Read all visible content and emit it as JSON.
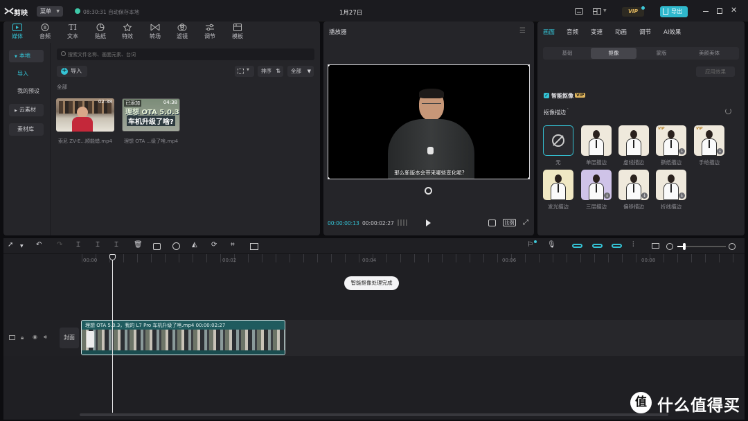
{
  "app": {
    "logo_text": "剪映",
    "menu_label": "菜单",
    "autosave": "08:30:31 自动保存本地",
    "title": "1月27日",
    "vip_label": "VIP",
    "export_label": "导出"
  },
  "media_tabs": [
    {
      "label": "媒体",
      "icon": "media-icon"
    },
    {
      "label": "音频",
      "icon": "audio-icon"
    },
    {
      "label": "文本",
      "icon": "text-icon"
    },
    {
      "label": "贴纸",
      "icon": "sticker-icon"
    },
    {
      "label": "特效",
      "icon": "effects-icon"
    },
    {
      "label": "转场",
      "icon": "transition-icon"
    },
    {
      "label": "滤镜",
      "icon": "filter-icon"
    },
    {
      "label": "调节",
      "icon": "adjust-icon"
    },
    {
      "label": "模板",
      "icon": "template-icon"
    }
  ],
  "sidebar": {
    "local": "本地",
    "import": "导入",
    "presets": "我的预设",
    "cloud": "云素材",
    "library": "素材库"
  },
  "search": {
    "placeholder": "搜索文件名称、画面元素、台词"
  },
  "media_toolbar": {
    "import": "导入",
    "sort": "排序",
    "all": "全部"
  },
  "section_all": "全部",
  "media_items": [
    {
      "name": "索尼 ZV-E...顺能蜡.mp4",
      "duration": "02:38"
    },
    {
      "name": "理想 OTA ...级了啥.mp4",
      "duration": "04:38",
      "badge": "已添加",
      "overlay_line1": "理想 OTA 5.0.3",
      "overlay_line2": "车机升级了啥?"
    }
  ],
  "player": {
    "title": "播放器",
    "subtitle": "那么新版本会带来哪些变化呢?",
    "current_time": "00:00:00:13",
    "total_time": "00:00:02:27",
    "ratio_label": "比例"
  },
  "right_tabs": [
    "画面",
    "音频",
    "变速",
    "动画",
    "调节",
    "AI效果"
  ],
  "sub_tabs": [
    "基础",
    "抠像",
    "蒙版",
    "美颜美体"
  ],
  "apply_effect": "应用效果",
  "smart_cutout": {
    "label": "智能抠像",
    "badge": "VIP",
    "checked": true
  },
  "cutout_stroke": {
    "title": "抠像描边"
  },
  "stroke_effects": [
    {
      "label": "无"
    },
    {
      "label": "单层描边"
    },
    {
      "label": "虚线描边"
    },
    {
      "label": "撕纸描边"
    },
    {
      "label": "手绘描边"
    },
    {
      "label": "发光描边"
    },
    {
      "label": "三层描边"
    },
    {
      "label": "偏移描边"
    },
    {
      "label": "折线描边"
    }
  ],
  "timeline": {
    "ticks": [
      "00:00",
      "00:02",
      "00:04",
      "00:06",
      "00:08"
    ],
    "toast": "智能抠像处理完成",
    "cover_label": "封面",
    "clip_label": "理想 OTA 5.0.3，我的 L7 Pro 车机升级了啥.mp4   00:00:02:27"
  },
  "watermark": {
    "text": "什么值得买",
    "logo_char": "值"
  },
  "colors": {
    "accent": "#34c4d6",
    "clip": "#1f5b5e",
    "vip": "#e0b65e"
  }
}
